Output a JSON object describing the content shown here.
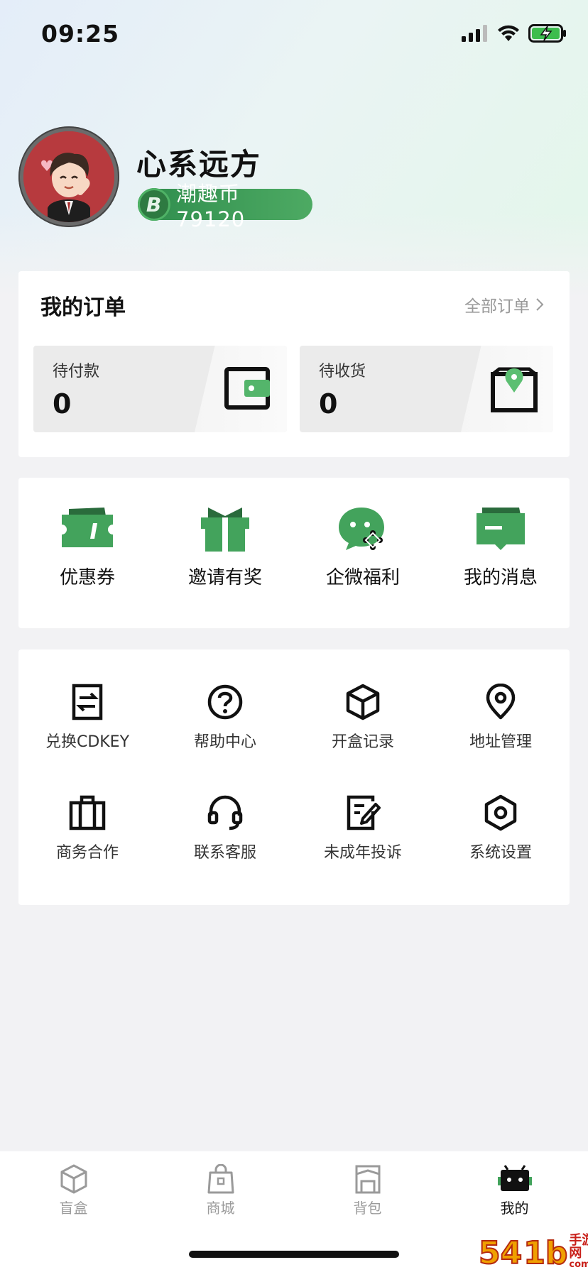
{
  "status_bar": {
    "time": "09:25"
  },
  "profile": {
    "username": "心系远方",
    "coin_badge_letter": "B",
    "coin_text": "潮趣币 79120"
  },
  "orders": {
    "title": "我的订单",
    "all_label": "全部订单",
    "pending_payment": {
      "label": "待付款",
      "count": "0"
    },
    "pending_receipt": {
      "label": "待收货",
      "count": "0"
    }
  },
  "quick_actions": [
    {
      "label": "优惠券",
      "icon": "ticket-icon"
    },
    {
      "label": "邀请有奖",
      "icon": "gift-icon"
    },
    {
      "label": "企微福利",
      "icon": "wecom-icon"
    },
    {
      "label": "我的消息",
      "icon": "message-icon"
    }
  ],
  "tools": [
    {
      "label": "兑换CDKEY",
      "icon": "exchange-icon"
    },
    {
      "label": "帮助中心",
      "icon": "help-icon"
    },
    {
      "label": "开盒记录",
      "icon": "box-icon"
    },
    {
      "label": "地址管理",
      "icon": "location-icon"
    },
    {
      "label": "商务合作",
      "icon": "briefcase-icon"
    },
    {
      "label": "联系客服",
      "icon": "headset-icon"
    },
    {
      "label": "未成年投诉",
      "icon": "edit-icon"
    },
    {
      "label": "系统设置",
      "icon": "settings-icon"
    }
  ],
  "tab_bar": {
    "items": [
      {
        "label": "盲盒",
        "icon": "cube-icon",
        "active": false
      },
      {
        "label": "商城",
        "icon": "shopping-bag-icon",
        "active": false
      },
      {
        "label": "背包",
        "icon": "backpack-icon",
        "active": false
      },
      {
        "label": "我的",
        "icon": "robot-icon",
        "active": true
      }
    ]
  },
  "colors": {
    "accent_green": "#43a35c",
    "text_primary": "#111111",
    "text_muted": "#9a9a9a"
  },
  "watermark": {
    "number": "54",
    "suffix": "1b",
    "text_top": "手游网",
    "text_bottom": "com.cn"
  }
}
